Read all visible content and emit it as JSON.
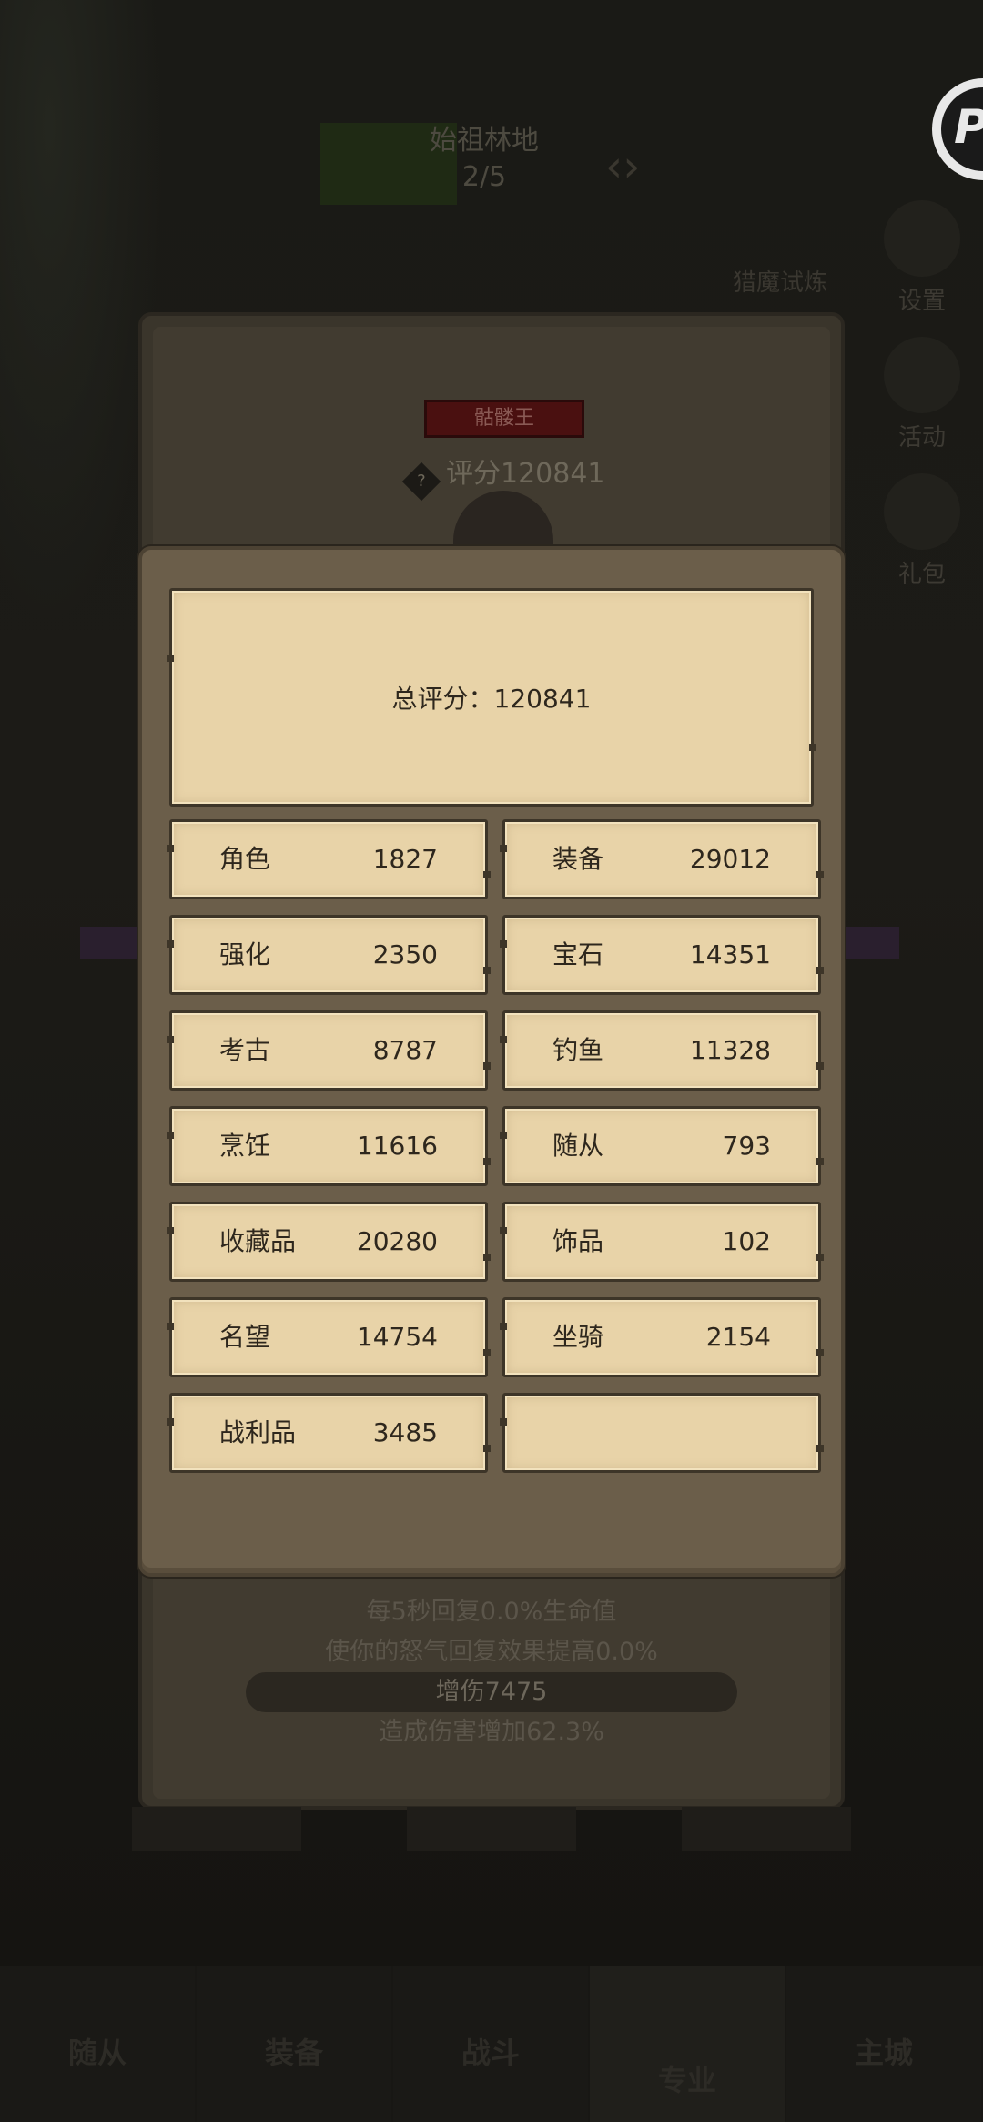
{
  "background": {
    "stage_name": "始祖林地",
    "stage_progress": "2/5",
    "quest_hint": "",
    "trial_label": "猎魔试炼",
    "side_buttons": [
      "设置",
      "活动",
      "礼包"
    ],
    "boss_name": "骷髅王",
    "score_label": "评分120841",
    "help_icon": "?",
    "effects": [
      "每5秒回复0.0%生命值",
      "使你的怒气回复效果提高0.0%",
      "增伤7475",
      "造成伤害增加62.3%"
    ],
    "action_buttons": [
      "",
      "",
      ""
    ],
    "bottom_nav": [
      "随从",
      "装备",
      "战斗",
      "专业",
      "主城"
    ]
  },
  "modal": {
    "total_label": "总评分：120841",
    "stats": [
      {
        "label": "角色",
        "value": "1827"
      },
      {
        "label": "装备",
        "value": "29012"
      },
      {
        "label": "强化",
        "value": "2350"
      },
      {
        "label": "宝石",
        "value": "14351"
      },
      {
        "label": "考古",
        "value": "8787"
      },
      {
        "label": "钓鱼",
        "value": "11328"
      },
      {
        "label": "烹饪",
        "value": "11616"
      },
      {
        "label": "随从",
        "value": "793"
      },
      {
        "label": "收藏品",
        "value": "20280"
      },
      {
        "label": "饰品",
        "value": "102"
      },
      {
        "label": "名望",
        "value": "14754"
      },
      {
        "label": "坐骑",
        "value": "2154"
      },
      {
        "label": "战利品",
        "value": "3485"
      },
      {
        "label": "",
        "value": ""
      }
    ]
  },
  "colors": {
    "parchment": "#e8d3a8",
    "modal_frame": "#6b5e4a",
    "text": "#2e271d",
    "boss_plate": "#4a1010"
  }
}
